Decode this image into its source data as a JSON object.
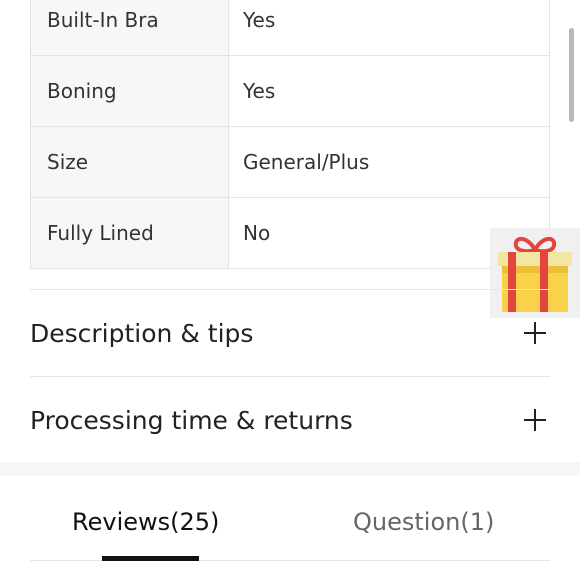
{
  "specs": [
    {
      "label": "Built-In Bra",
      "value": "Yes"
    },
    {
      "label": "Boning",
      "value": "Yes"
    },
    {
      "label": "Size",
      "value": "General/Plus"
    },
    {
      "label": "Fully Lined",
      "value": "No"
    }
  ],
  "sections": {
    "description": "Description & tips",
    "processing": "Processing time & returns"
  },
  "tabs": {
    "reviews": "Reviews(25)",
    "questions": "Question(1)"
  },
  "icons": {
    "expand": "plus-icon",
    "gift": "gift-icon"
  },
  "colors": {
    "gift_ribbon": "#e2453c",
    "gift_box": "#f8d24a"
  }
}
